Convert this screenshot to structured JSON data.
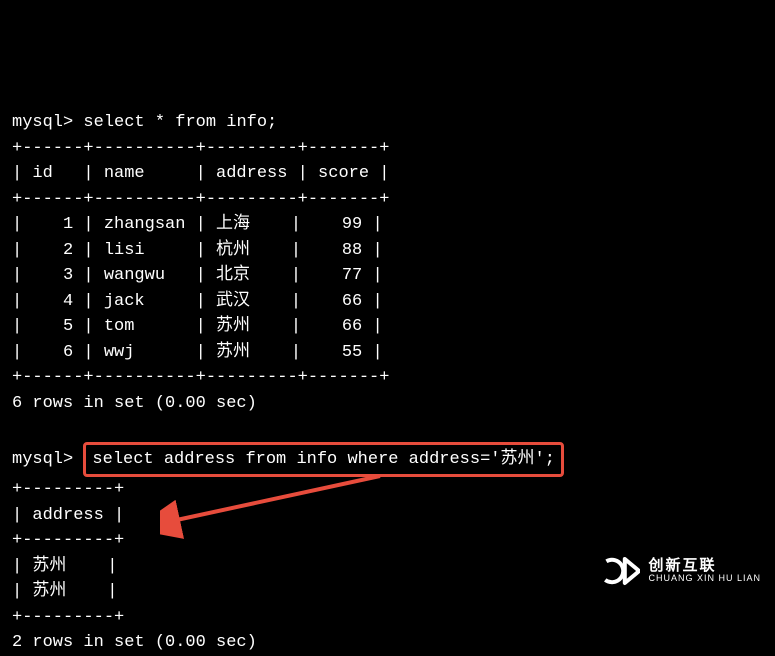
{
  "prompt_label": "mysql>",
  "query1": "select * from info;",
  "query2": "select address from info where address='苏州';",
  "table1": {
    "separator": "+------+----------+---------+-------+",
    "separator_cn": "+------+----------+--------+-------+",
    "header": "| id   | name     | address | score |",
    "rows_text": [
      "|    1 | zhangsan | 上海    |    99 |",
      "|    2 | lisi     | 杭州    |    88 |",
      "|    3 | wangwu   | 北京    |    77 |",
      "|    4 | jack     | 武汉    |    66 |",
      "|    5 | tom      | 苏州    |    66 |",
      "|    6 | wwj      | 苏州    |    55 |"
    ],
    "footer": "6 rows in set (0.00 sec)"
  },
  "table2": {
    "separator": "+---------+",
    "separator_cn": "+--------+",
    "header": "| address |",
    "rows_text": [
      "| 苏州    |",
      "| 苏州    |"
    ],
    "footer": "2 rows in set (0.00 sec)"
  },
  "chart_data": {
    "type": "table",
    "table1": {
      "columns": [
        "id",
        "name",
        "address",
        "score"
      ],
      "rows": [
        [
          1,
          "zhangsan",
          "上海",
          99
        ],
        [
          2,
          "lisi",
          "杭州",
          88
        ],
        [
          3,
          "wangwu",
          "北京",
          77
        ],
        [
          4,
          "jack",
          "武汉",
          66
        ],
        [
          5,
          "tom",
          "苏州",
          66
        ],
        [
          6,
          "wwj",
          "苏州",
          55
        ]
      ]
    },
    "table2": {
      "columns": [
        "address"
      ],
      "rows": [
        [
          "苏州"
        ],
        [
          "苏州"
        ]
      ]
    }
  },
  "watermark": {
    "cn": "创新互联",
    "en": "CHUANG XIN HU LIAN"
  }
}
